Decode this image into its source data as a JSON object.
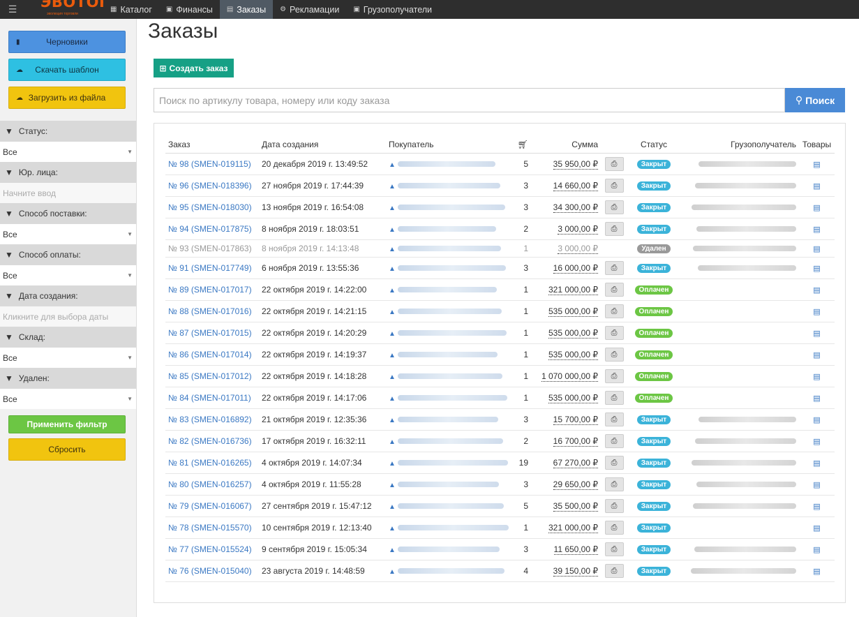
{
  "nav": {
    "logo": "ЭВОТОР",
    "logo_sub": "эволюция торговли",
    "items": [
      {
        "label": "Каталог",
        "icon": "sitemap-icon"
      },
      {
        "label": "Финансы",
        "icon": "money-icon"
      },
      {
        "label": "Заказы",
        "icon": "list-icon",
        "active": true
      },
      {
        "label": "Рекламации",
        "icon": "gear-icon"
      },
      {
        "label": "Грузополучатели",
        "icon": "box-icon"
      }
    ]
  },
  "sidebar": {
    "btn_drafts": "Черновики",
    "btn_download": "Скачать шаблон",
    "btn_upload": "Загрузить из файла",
    "filters": {
      "status": {
        "label": "Статус:",
        "value": "Все"
      },
      "legal": {
        "label": "Юр. лица:",
        "placeholder": "Начните ввод"
      },
      "delivery": {
        "label": "Способ поставки:",
        "value": "Все"
      },
      "payment": {
        "label": "Способ оплаты:",
        "value": "Все"
      },
      "created": {
        "label": "Дата создания:",
        "placeholder": "Кликните для выбора даты"
      },
      "warehouse": {
        "label": "Склад:",
        "value": "Все"
      },
      "deleted": {
        "label": "Удален:",
        "value": "Все"
      }
    },
    "btn_apply": "Применить фильтр",
    "btn_reset": "Сбросить"
  },
  "main": {
    "title": "Заказы",
    "create_label": "Создать заказ",
    "search_placeholder": "Поиск по артикулу товара, номеру или коду заказа",
    "search_label": "Поиск"
  },
  "table": {
    "headers": {
      "order": "Заказ",
      "date": "Дата создания",
      "buyer": "Покупатель",
      "sum": "Сумма",
      "status": "Статус",
      "consignee": "Грузополучатель",
      "goods": "Товары"
    },
    "rows": [
      {
        "order": "№ 98 (SMEN-019115)",
        "date": "20 декабря 2019 г. 13:49:52",
        "qty": "5",
        "sum": "35 950,00 ₽",
        "status": "Закрыт",
        "kind": "closed",
        "consignee": true,
        "print": true
      },
      {
        "order": "№ 96 (SMEN-018396)",
        "date": "27 ноября 2019 г. 17:44:39",
        "qty": "3",
        "sum": "14 660,00 ₽",
        "status": "Закрыт",
        "kind": "closed",
        "consignee": true,
        "print": true
      },
      {
        "order": "№ 95 (SMEN-018030)",
        "date": "13 ноября 2019 г. 16:54:08",
        "qty": "3",
        "sum": "34 300,00 ₽",
        "status": "Закрыт",
        "kind": "closed",
        "consignee": true,
        "print": true
      },
      {
        "order": "№ 94 (SMEN-017875)",
        "date": "8 ноября 2019 г. 18:03:51",
        "qty": "2",
        "sum": "3 000,00 ₽",
        "status": "Закрыт",
        "kind": "closed",
        "consignee": true,
        "print": true
      },
      {
        "order": "№ 93 (SMEN-017863)",
        "date": "8 ноября 2019 г. 14:13:48",
        "qty": "1",
        "sum": "3 000,00 ₽",
        "status": "Удален",
        "kind": "deleted",
        "consignee": true,
        "print": false
      },
      {
        "order": "№ 91 (SMEN-017749)",
        "date": "6 ноября 2019 г. 13:55:36",
        "qty": "3",
        "sum": "16 000,00 ₽",
        "status": "Закрыт",
        "kind": "closed",
        "consignee": true,
        "print": true
      },
      {
        "order": "№ 89 (SMEN-017017)",
        "date": "22 октября 2019 г. 14:22:00",
        "qty": "1",
        "sum": "321 000,00 ₽",
        "status": "Оплачен",
        "kind": "paid",
        "consignee": false,
        "print": true
      },
      {
        "order": "№ 88 (SMEN-017016)",
        "date": "22 октября 2019 г. 14:21:15",
        "qty": "1",
        "sum": "535 000,00 ₽",
        "status": "Оплачен",
        "kind": "paid",
        "consignee": false,
        "print": true
      },
      {
        "order": "№ 87 (SMEN-017015)",
        "date": "22 октября 2019 г. 14:20:29",
        "qty": "1",
        "sum": "535 000,00 ₽",
        "status": "Оплачен",
        "kind": "paid",
        "consignee": false,
        "print": true
      },
      {
        "order": "№ 86 (SMEN-017014)",
        "date": "22 октября 2019 г. 14:19:37",
        "qty": "1",
        "sum": "535 000,00 ₽",
        "status": "Оплачен",
        "kind": "paid",
        "consignee": false,
        "print": true
      },
      {
        "order": "№ 85 (SMEN-017012)",
        "date": "22 октября 2019 г. 14:18:28",
        "qty": "1",
        "sum": "1 070 000,00 ₽",
        "status": "Оплачен",
        "kind": "paid",
        "consignee": false,
        "print": true
      },
      {
        "order": "№ 84 (SMEN-017011)",
        "date": "22 октября 2019 г. 14:17:06",
        "qty": "1",
        "sum": "535 000,00 ₽",
        "status": "Оплачен",
        "kind": "paid",
        "consignee": false,
        "print": true
      },
      {
        "order": "№ 83 (SMEN-016892)",
        "date": "21 октября 2019 г. 12:35:36",
        "qty": "3",
        "sum": "15 700,00 ₽",
        "status": "Закрыт",
        "kind": "closed",
        "consignee": true,
        "print": true
      },
      {
        "order": "№ 82 (SMEN-016736)",
        "date": "17 октября 2019 г. 16:32:11",
        "qty": "2",
        "sum": "16 700,00 ₽",
        "status": "Закрыт",
        "kind": "closed",
        "consignee": true,
        "print": true
      },
      {
        "order": "№ 81 (SMEN-016265)",
        "date": "4 октября 2019 г. 14:07:34",
        "qty": "19",
        "sum": "67 270,00 ₽",
        "status": "Закрыт",
        "kind": "closed",
        "consignee": true,
        "print": true
      },
      {
        "order": "№ 80 (SMEN-016257)",
        "date": "4 октября 2019 г. 11:55:28",
        "qty": "3",
        "sum": "29 650,00 ₽",
        "status": "Закрыт",
        "kind": "closed",
        "consignee": true,
        "print": true
      },
      {
        "order": "№ 79 (SMEN-016067)",
        "date": "27 сентября 2019 г. 15:47:12",
        "qty": "5",
        "sum": "35 500,00 ₽",
        "status": "Закрыт",
        "kind": "closed",
        "consignee": true,
        "print": true
      },
      {
        "order": "№ 78 (SMEN-015570)",
        "date": "10 сентября 2019 г. 12:13:40",
        "qty": "1",
        "sum": "321 000,00 ₽",
        "status": "Закрыт",
        "kind": "closed",
        "consignee": false,
        "print": true
      },
      {
        "order": "№ 77 (SMEN-015524)",
        "date": "9 сентября 2019 г. 15:05:34",
        "qty": "3",
        "sum": "11 650,00 ₽",
        "status": "Закрыт",
        "kind": "closed",
        "consignee": true,
        "print": true
      },
      {
        "order": "№ 76 (SMEN-015040)",
        "date": "23 августа 2019 г. 14:48:59",
        "qty": "4",
        "sum": "39 150,00 ₽",
        "status": "Закрыт",
        "kind": "closed",
        "consignee": true,
        "print": true
      }
    ]
  }
}
